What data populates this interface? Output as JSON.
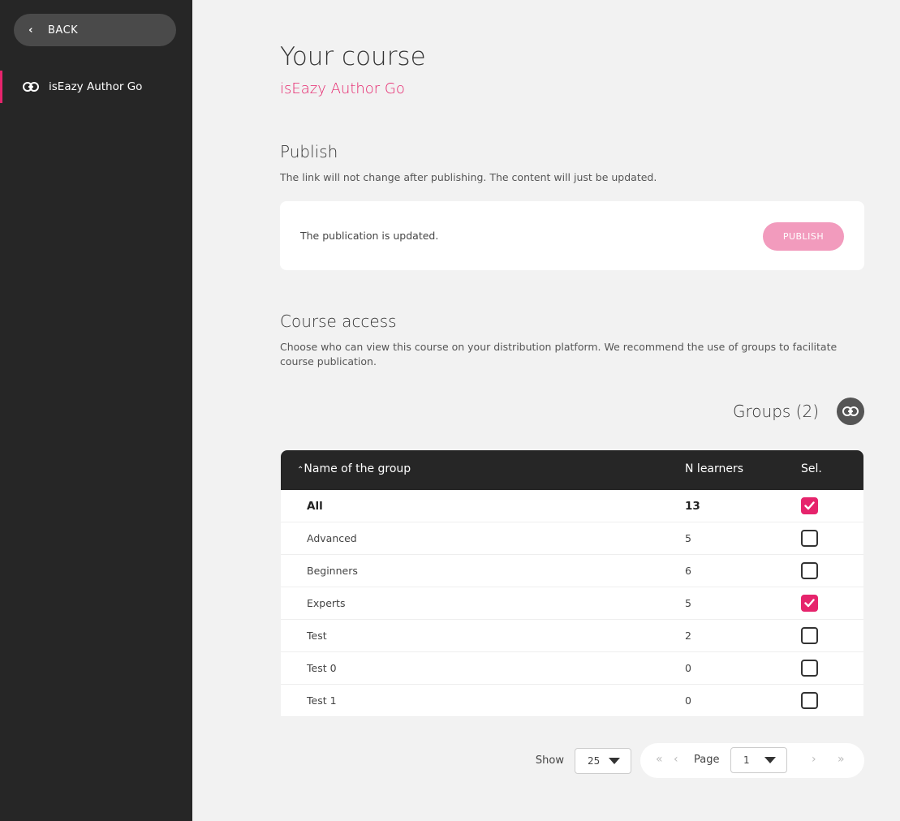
{
  "sidebar": {
    "back_label": "BACK",
    "items": [
      {
        "label": "isEazy Author Go",
        "icon": "link-icon",
        "active": true
      }
    ]
  },
  "header": {
    "title": "Your course",
    "subtitle": "isEazy Author Go"
  },
  "publish": {
    "title": "Publish",
    "description": "The link will not change after publishing. The content will just be updated.",
    "status": "The publication is updated.",
    "button": "PUBLISH"
  },
  "access": {
    "title": "Course access",
    "description": "Choose who can view this course on your distribution platform. We recommend the use of groups to facilitate course publication."
  },
  "groups": {
    "title": "Groups (2)",
    "columns": {
      "name": "Name of the group",
      "learners": "N learners",
      "sel": "Sel."
    },
    "rows": [
      {
        "name": "All",
        "learners": "13",
        "selected": true
      },
      {
        "name": "Advanced",
        "learners": "5",
        "selected": false
      },
      {
        "name": "Beginners",
        "learners": "6",
        "selected": false
      },
      {
        "name": "Experts",
        "learners": "5",
        "selected": true
      },
      {
        "name": "Test",
        "learners": "2",
        "selected": false
      },
      {
        "name": "Test 0",
        "learners": "0",
        "selected": false
      },
      {
        "name": "Test 1",
        "learners": "0",
        "selected": false
      }
    ]
  },
  "pagination": {
    "show_label": "Show",
    "page_size": "25",
    "page_label": "Page",
    "page": "1"
  },
  "colors": {
    "accent": "#e6246c",
    "sidebar": "#262626",
    "publish_button": "#f29bbd"
  }
}
